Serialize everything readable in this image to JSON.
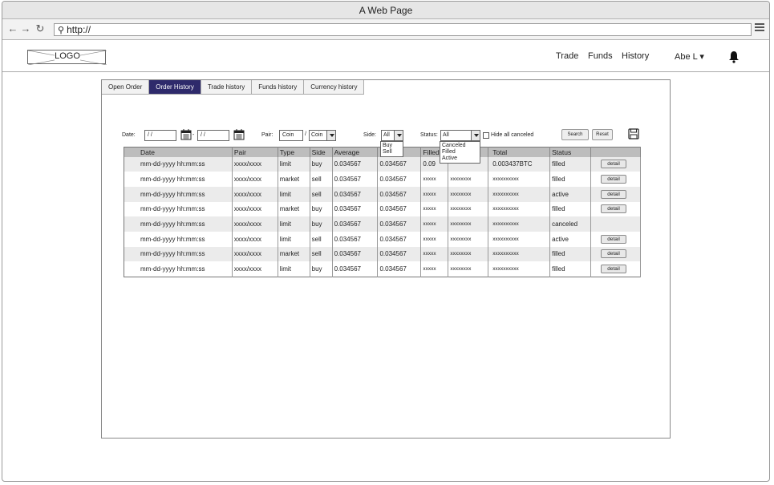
{
  "window": {
    "title": "A Web Page"
  },
  "browser": {
    "url": "http://"
  },
  "nav": {
    "logo": "LOGO",
    "links": [
      "Trade",
      "Funds",
      "History"
    ],
    "user": "Abe L ▾"
  },
  "tabs": [
    "Open Order",
    "Order History",
    "Trade history",
    "Funds history",
    "Currency history"
  ],
  "active_tab": "Order History",
  "filters": {
    "date_label": "Date:",
    "date_from": "/ /",
    "date_sep": "-",
    "date_to": "/ /",
    "pair_label": "Pair:",
    "pair_coin": "Coin",
    "pair_sep": "/",
    "pair_coin2": "Coin",
    "side_label": "Side:",
    "side_value": "All",
    "side_options": [
      "Buy",
      "Sell"
    ],
    "status_label": "Status:",
    "status_value": "All",
    "status_options": [
      "Canceled",
      "Filled",
      "Active"
    ],
    "hide_canceled_label": "Hide all canceled",
    "search_label": "Search",
    "reset_label": "Reset"
  },
  "table": {
    "headers": [
      "Date",
      "Pair",
      "Type",
      "Side",
      "Average",
      "",
      "Filled",
      "",
      "Total",
      "Status",
      ""
    ],
    "first_row_filled": "0.09",
    "first_row_total": "0.003437BTC",
    "rows": [
      {
        "date": "mm-dd-yyyy hh:mm:ss",
        "pair": "xxxx/xxxx",
        "type": "limit",
        "side": "buy",
        "average": "0.034567",
        "price": "0.034567",
        "filled": "0.09",
        "amount": "",
        "total": "0.003437BTC",
        "status": "filled",
        "action": "detail"
      },
      {
        "date": "mm-dd-yyyy hh:mm:ss",
        "pair": "xxxx/xxxx",
        "type": "market",
        "side": "sell",
        "average": "0.034567",
        "price": "0.034567",
        "filled": "xxxxx",
        "amount": "xxxxxxxx",
        "total": "xxxxxxxxxx",
        "status": "filled",
        "action": "detail"
      },
      {
        "date": "mm-dd-yyyy hh:mm:ss",
        "pair": "xxxx/xxxx",
        "type": "limit",
        "side": "sell",
        "average": "0.034567",
        "price": "0.034567",
        "filled": "xxxxx",
        "amount": "xxxxxxxx",
        "total": "xxxxxxxxxx",
        "status": "active",
        "action": "detail"
      },
      {
        "date": "mm-dd-yyyy hh:mm:ss",
        "pair": "xxxx/xxxx",
        "type": "market",
        "side": "buy",
        "average": "0.034567",
        "price": "0.034567",
        "filled": "xxxxx",
        "amount": "xxxxxxxx",
        "total": "xxxxxxxxxx",
        "status": "filled",
        "action": "detail"
      },
      {
        "date": "mm-dd-yyyy hh:mm:ss",
        "pair": "xxxx/xxxx",
        "type": "limit",
        "side": "buy",
        "average": "0.034567",
        "price": "0.034567",
        "filled": "xxxxx",
        "amount": "xxxxxxxx",
        "total": "xxxxxxxxxx",
        "status": "canceled",
        "action": ""
      },
      {
        "date": "mm-dd-yyyy hh:mm:ss",
        "pair": "xxxx/xxxx",
        "type": "limit",
        "side": "sell",
        "average": "0.034567",
        "price": "0.034567",
        "filled": "xxxxx",
        "amount": "xxxxxxxx",
        "total": "xxxxxxxxxx",
        "status": "active",
        "action": "detail"
      },
      {
        "date": "mm-dd-yyyy hh:mm:ss",
        "pair": "xxxx/xxxx",
        "type": "market",
        "side": "sell",
        "average": "0.034567",
        "price": "0.034567",
        "filled": "xxxxx",
        "amount": "xxxxxxxx",
        "total": "xxxxxxxxxx",
        "status": "filled",
        "action": "detail"
      },
      {
        "date": "mm-dd-yyyy hh:mm:ss",
        "pair": "xxxx/xxxx",
        "type": "limit",
        "side": "buy",
        "average": "0.034567",
        "price": "0.034567",
        "filled": "xxxxx",
        "amount": "xxxxxxxx",
        "total": "xxxxxxxxxx",
        "status": "filled",
        "action": "detail"
      }
    ]
  },
  "colors": {
    "active_tab_bg": "#2e2a6b",
    "header_bg": "#bdbdbd",
    "alt_row_bg": "#ebebeb"
  }
}
